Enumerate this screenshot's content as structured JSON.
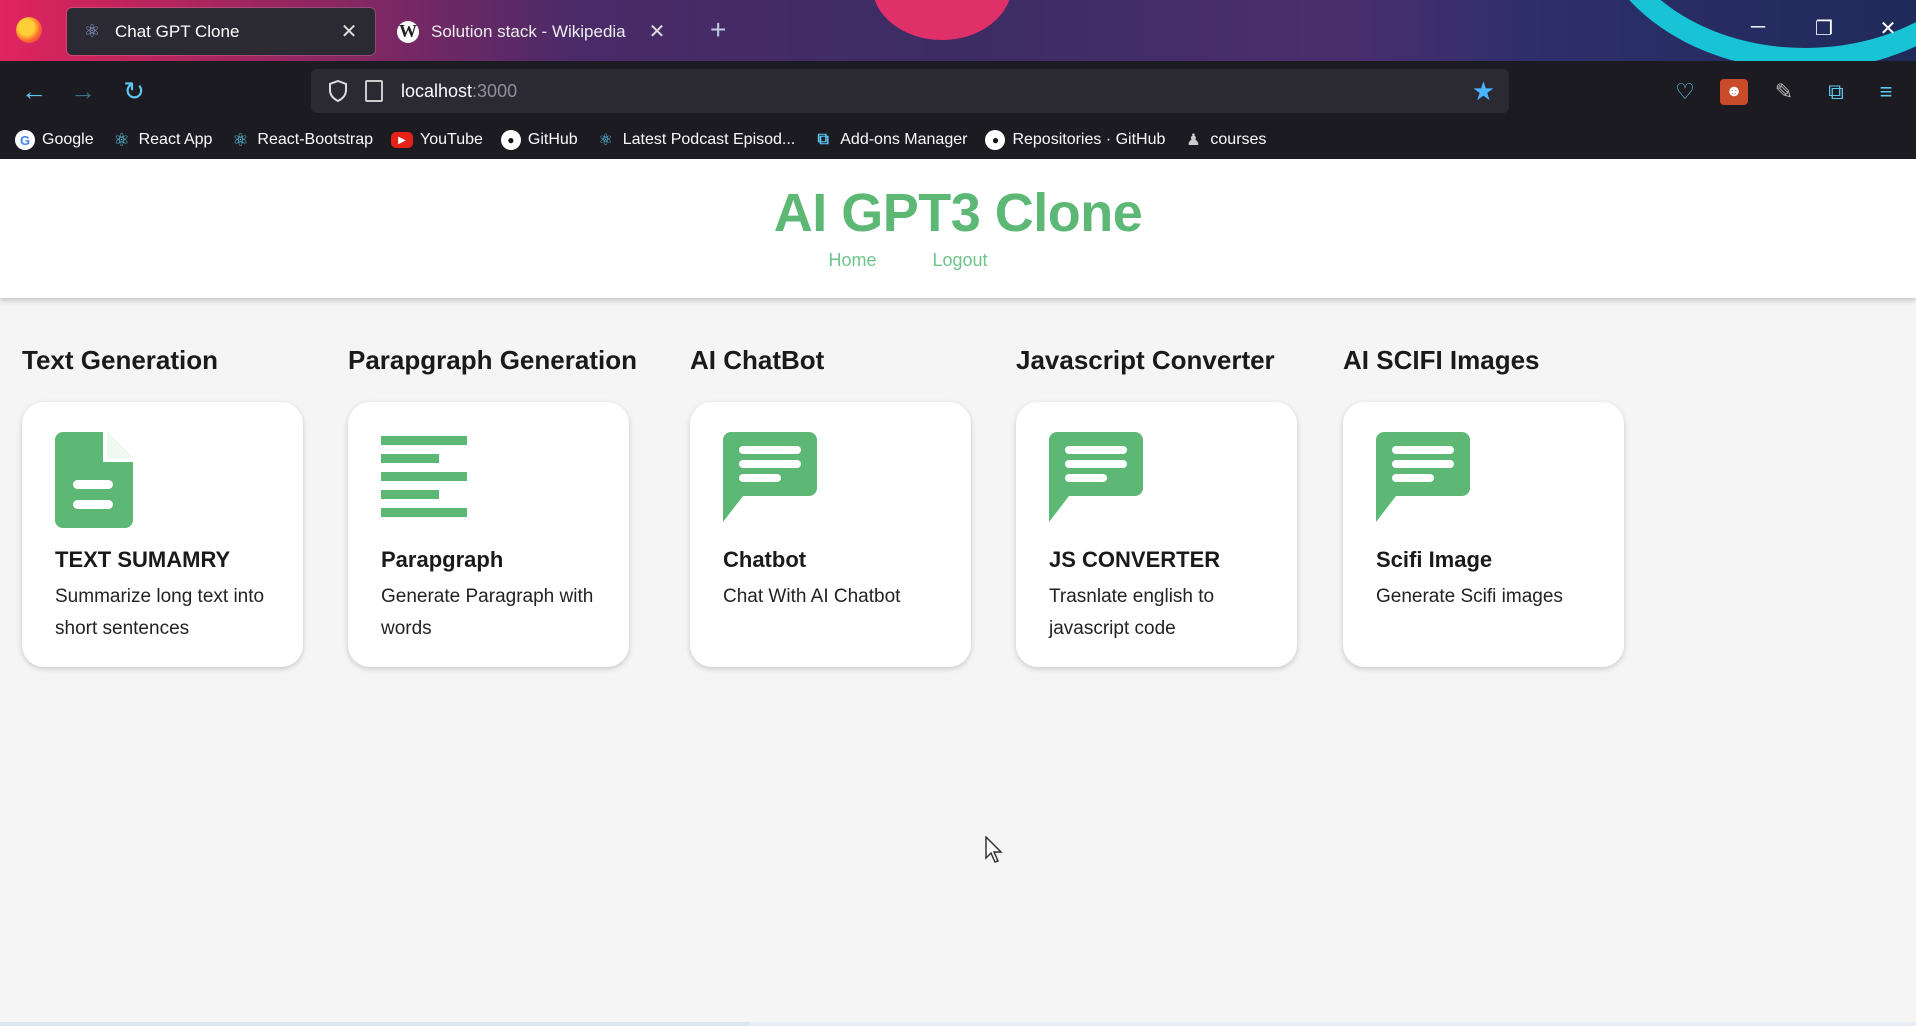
{
  "browser": {
    "tabs": [
      {
        "title": "Chat GPT Clone",
        "icon": "react-icon",
        "active": true
      },
      {
        "title": "Solution stack - Wikipedia",
        "icon": "wikipedia-icon",
        "active": false
      }
    ],
    "url_host": "localhost",
    "url_port": ":3000",
    "bookmarks": [
      {
        "label": "Google",
        "icon": "google-icon"
      },
      {
        "label": "React App",
        "icon": "react-icon"
      },
      {
        "label": "React-Bootstrap",
        "icon": "react-icon"
      },
      {
        "label": "YouTube",
        "icon": "youtube-icon"
      },
      {
        "label": "GitHub",
        "icon": "github-icon"
      },
      {
        "label": "Latest Podcast Episod...",
        "icon": "podcast-icon"
      },
      {
        "label": "Add-ons Manager",
        "icon": "puzzle-icon"
      },
      {
        "label": "Repositories · GitHub",
        "icon": "github-icon"
      },
      {
        "label": "courses",
        "icon": "user-icon"
      }
    ]
  },
  "app": {
    "title": "AI GPT3 Clone",
    "nav": [
      {
        "label": "Home"
      },
      {
        "label": "Logout"
      }
    ],
    "accent_color": "#5cb874"
  },
  "sections": [
    {
      "heading": "Text Generation",
      "card_title": "TEXT SUMAMRY",
      "card_desc": "Summarize long text into short sentences",
      "icon": "document-icon"
    },
    {
      "heading": "Parapgraph Generation",
      "card_title": "Parapgraph",
      "card_desc": "Generate Paragraph with words",
      "icon": "paragraph-icon"
    },
    {
      "heading": "AI ChatBot",
      "card_title": "Chatbot",
      "card_desc": "Chat With AI Chatbot",
      "icon": "chat-icon"
    },
    {
      "heading": "Javascript Converter",
      "card_title": "JS CONVERTER",
      "card_desc": "Trasnlate english to javascript code",
      "icon": "chat-icon"
    },
    {
      "heading": "AI SCIFI Images",
      "card_title": "Scifi Image",
      "card_desc": "Generate Scifi images",
      "icon": "chat-icon"
    }
  ]
}
